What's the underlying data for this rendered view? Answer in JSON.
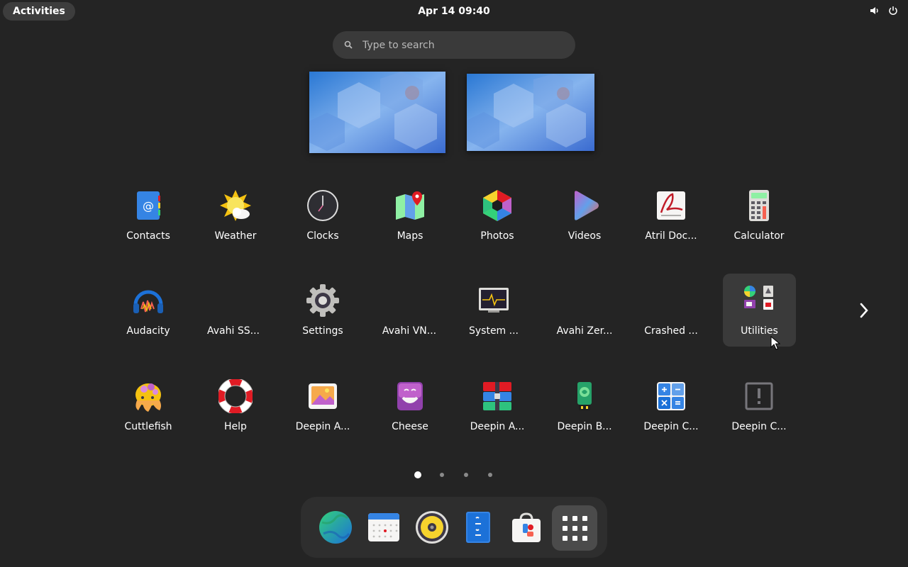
{
  "topbar": {
    "activities_label": "Activities",
    "datetime": "Apr 14  09:40",
    "tray_icons": [
      "volume-icon",
      "power-icon"
    ]
  },
  "search": {
    "placeholder": "Type to search",
    "value": ""
  },
  "workspaces": [
    "workspace-1",
    "workspace-2"
  ],
  "app_grid": {
    "rows": [
      [
        {
          "label": "Contacts",
          "icon": "contacts-icon"
        },
        {
          "label": "Weather",
          "icon": "weather-icon"
        },
        {
          "label": "Clocks",
          "icon": "clocks-icon"
        },
        {
          "label": "Maps",
          "icon": "maps-icon"
        },
        {
          "label": "Photos",
          "icon": "photos-icon"
        },
        {
          "label": "Videos",
          "icon": "videos-icon"
        },
        {
          "label": "Atril Doc...",
          "icon": "atril-icon"
        },
        {
          "label": "Calculator",
          "icon": "calculator-icon"
        }
      ],
      [
        {
          "label": "Audacity",
          "icon": "audacity-icon"
        },
        {
          "label": "Avahi SS...",
          "icon": "avahi-ssh-icon"
        },
        {
          "label": "Settings",
          "icon": "settings-icon"
        },
        {
          "label": "Avahi VN...",
          "icon": "avahi-vnc-icon"
        },
        {
          "label": "System ...",
          "icon": "system-monitor-icon"
        },
        {
          "label": "Avahi Zer...",
          "icon": "avahi-zeroconf-icon"
        },
        {
          "label": "Crashed ...",
          "icon": "crashed-icon"
        },
        {
          "label": "Utilities",
          "icon": "utilities-folder-icon"
        }
      ],
      [
        {
          "label": "Cuttlefish",
          "icon": "cuttlefish-icon"
        },
        {
          "label": "Help",
          "icon": "help-icon"
        },
        {
          "label": "Deepin A...",
          "icon": "deepin-album-icon"
        },
        {
          "label": "Cheese",
          "icon": "cheese-icon"
        },
        {
          "label": "Deepin A...",
          "icon": "deepin-archive-icon"
        },
        {
          "label": "Deepin B...",
          "icon": "deepin-boot-maker-icon"
        },
        {
          "label": "Deepin C...",
          "icon": "deepin-calculator-icon"
        },
        {
          "label": "Deepin C...",
          "icon": "deepin-generic-icon"
        }
      ]
    ]
  },
  "pagination": {
    "pages": 4,
    "current": 1
  },
  "dock": {
    "items": [
      "browser-icon",
      "calendar-icon",
      "rhythmbox-icon",
      "text-editor-icon",
      "software-store-icon",
      "show-apps-icon"
    ]
  }
}
